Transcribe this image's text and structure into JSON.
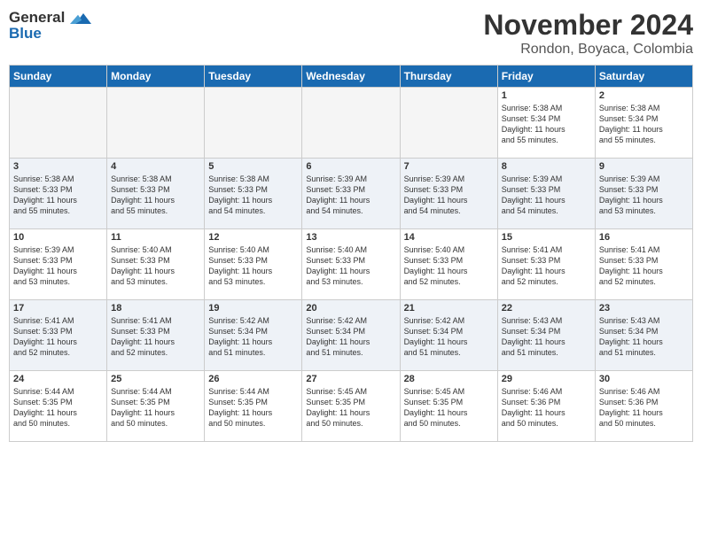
{
  "header": {
    "logo_line1": "General",
    "logo_line2": "Blue",
    "month": "November 2024",
    "location": "Rondon, Boyaca, Colombia"
  },
  "days_of_week": [
    "Sunday",
    "Monday",
    "Tuesday",
    "Wednesday",
    "Thursday",
    "Friday",
    "Saturday"
  ],
  "weeks": [
    [
      {
        "day": "",
        "info": ""
      },
      {
        "day": "",
        "info": ""
      },
      {
        "day": "",
        "info": ""
      },
      {
        "day": "",
        "info": ""
      },
      {
        "day": "",
        "info": ""
      },
      {
        "day": "1",
        "info": "Sunrise: 5:38 AM\nSunset: 5:34 PM\nDaylight: 11 hours\nand 55 minutes."
      },
      {
        "day": "2",
        "info": "Sunrise: 5:38 AM\nSunset: 5:34 PM\nDaylight: 11 hours\nand 55 minutes."
      }
    ],
    [
      {
        "day": "3",
        "info": "Sunrise: 5:38 AM\nSunset: 5:33 PM\nDaylight: 11 hours\nand 55 minutes."
      },
      {
        "day": "4",
        "info": "Sunrise: 5:38 AM\nSunset: 5:33 PM\nDaylight: 11 hours\nand 55 minutes."
      },
      {
        "day": "5",
        "info": "Sunrise: 5:38 AM\nSunset: 5:33 PM\nDaylight: 11 hours\nand 54 minutes."
      },
      {
        "day": "6",
        "info": "Sunrise: 5:39 AM\nSunset: 5:33 PM\nDaylight: 11 hours\nand 54 minutes."
      },
      {
        "day": "7",
        "info": "Sunrise: 5:39 AM\nSunset: 5:33 PM\nDaylight: 11 hours\nand 54 minutes."
      },
      {
        "day": "8",
        "info": "Sunrise: 5:39 AM\nSunset: 5:33 PM\nDaylight: 11 hours\nand 54 minutes."
      },
      {
        "day": "9",
        "info": "Sunrise: 5:39 AM\nSunset: 5:33 PM\nDaylight: 11 hours\nand 53 minutes."
      }
    ],
    [
      {
        "day": "10",
        "info": "Sunrise: 5:39 AM\nSunset: 5:33 PM\nDaylight: 11 hours\nand 53 minutes."
      },
      {
        "day": "11",
        "info": "Sunrise: 5:40 AM\nSunset: 5:33 PM\nDaylight: 11 hours\nand 53 minutes."
      },
      {
        "day": "12",
        "info": "Sunrise: 5:40 AM\nSunset: 5:33 PM\nDaylight: 11 hours\nand 53 minutes."
      },
      {
        "day": "13",
        "info": "Sunrise: 5:40 AM\nSunset: 5:33 PM\nDaylight: 11 hours\nand 53 minutes."
      },
      {
        "day": "14",
        "info": "Sunrise: 5:40 AM\nSunset: 5:33 PM\nDaylight: 11 hours\nand 52 minutes."
      },
      {
        "day": "15",
        "info": "Sunrise: 5:41 AM\nSunset: 5:33 PM\nDaylight: 11 hours\nand 52 minutes."
      },
      {
        "day": "16",
        "info": "Sunrise: 5:41 AM\nSunset: 5:33 PM\nDaylight: 11 hours\nand 52 minutes."
      }
    ],
    [
      {
        "day": "17",
        "info": "Sunrise: 5:41 AM\nSunset: 5:33 PM\nDaylight: 11 hours\nand 52 minutes."
      },
      {
        "day": "18",
        "info": "Sunrise: 5:41 AM\nSunset: 5:33 PM\nDaylight: 11 hours\nand 52 minutes."
      },
      {
        "day": "19",
        "info": "Sunrise: 5:42 AM\nSunset: 5:34 PM\nDaylight: 11 hours\nand 51 minutes."
      },
      {
        "day": "20",
        "info": "Sunrise: 5:42 AM\nSunset: 5:34 PM\nDaylight: 11 hours\nand 51 minutes."
      },
      {
        "day": "21",
        "info": "Sunrise: 5:42 AM\nSunset: 5:34 PM\nDaylight: 11 hours\nand 51 minutes."
      },
      {
        "day": "22",
        "info": "Sunrise: 5:43 AM\nSunset: 5:34 PM\nDaylight: 11 hours\nand 51 minutes."
      },
      {
        "day": "23",
        "info": "Sunrise: 5:43 AM\nSunset: 5:34 PM\nDaylight: 11 hours\nand 51 minutes."
      }
    ],
    [
      {
        "day": "24",
        "info": "Sunrise: 5:44 AM\nSunset: 5:35 PM\nDaylight: 11 hours\nand 50 minutes."
      },
      {
        "day": "25",
        "info": "Sunrise: 5:44 AM\nSunset: 5:35 PM\nDaylight: 11 hours\nand 50 minutes."
      },
      {
        "day": "26",
        "info": "Sunrise: 5:44 AM\nSunset: 5:35 PM\nDaylight: 11 hours\nand 50 minutes."
      },
      {
        "day": "27",
        "info": "Sunrise: 5:45 AM\nSunset: 5:35 PM\nDaylight: 11 hours\nand 50 minutes."
      },
      {
        "day": "28",
        "info": "Sunrise: 5:45 AM\nSunset: 5:35 PM\nDaylight: 11 hours\nand 50 minutes."
      },
      {
        "day": "29",
        "info": "Sunrise: 5:46 AM\nSunset: 5:36 PM\nDaylight: 11 hours\nand 50 minutes."
      },
      {
        "day": "30",
        "info": "Sunrise: 5:46 AM\nSunset: 5:36 PM\nDaylight: 11 hours\nand 50 minutes."
      }
    ]
  ]
}
